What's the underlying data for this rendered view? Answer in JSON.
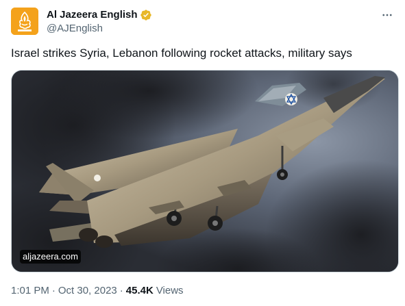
{
  "account": {
    "display_name": "Al Jazeera English",
    "handle": "@AJEnglish",
    "verified_badge_color": "#e8b829",
    "avatar_bg": "#f4a21b"
  },
  "menu": {
    "icon": "more-horizontal-icon"
  },
  "tweet": {
    "text": "Israel strikes Syria, Lebanon following rocket attacks, military says"
  },
  "media": {
    "source_label": "aljazeera.com"
  },
  "meta": {
    "time": "1:01 PM",
    "separator": "·",
    "date": "Oct 30, 2023",
    "views_count": "45.4K",
    "views_label": "Views"
  },
  "colors": {
    "text_primary": "#0f1419",
    "text_secondary": "#536471",
    "border": "#cfd9de"
  }
}
